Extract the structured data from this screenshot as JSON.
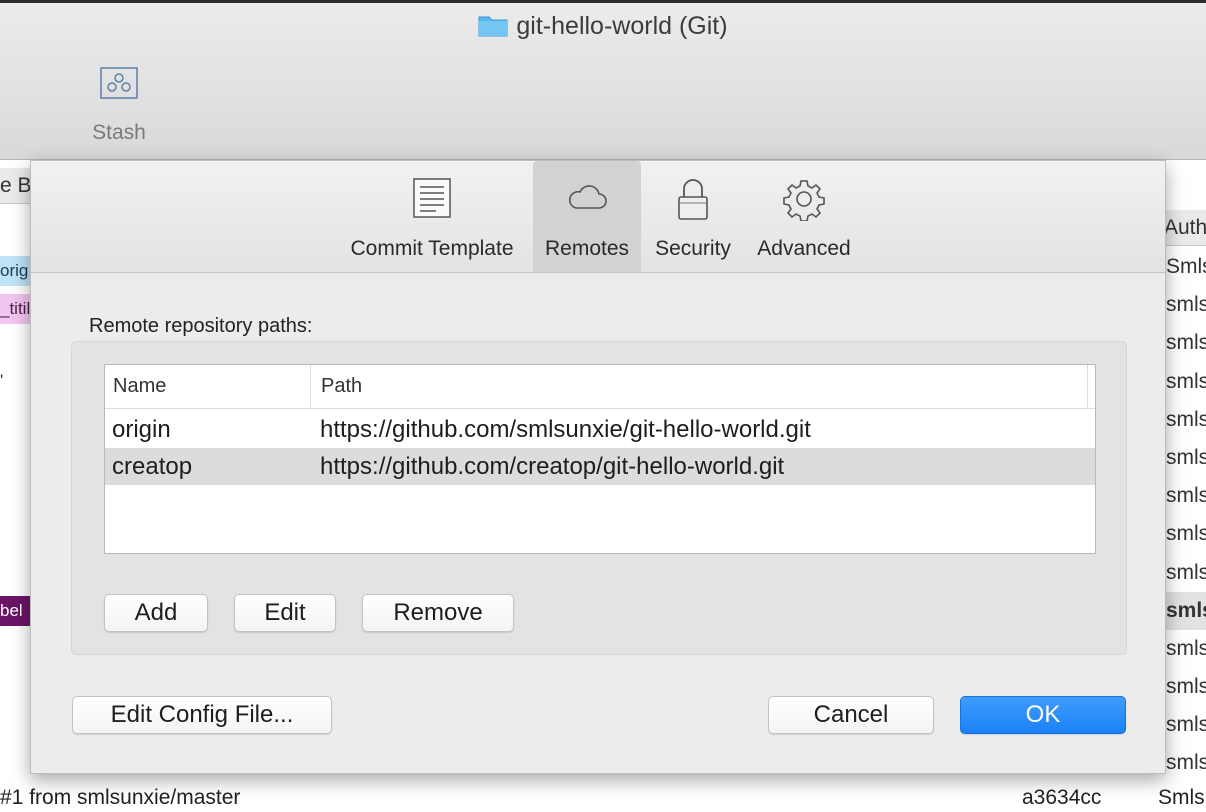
{
  "window": {
    "title": "git-hello-world (Git)",
    "toolbar": {
      "stash_label": "Stash"
    }
  },
  "background": {
    "left_header": "e B",
    "left_tags": [
      "orig",
      "_titil",
      "'",
      "bel"
    ],
    "author_header": "Auth",
    "authors": [
      "Smls",
      "smls",
      "smls",
      "smls",
      "smls",
      "smls",
      "smls",
      "smls",
      "smls",
      "smls",
      "smls",
      "smls",
      "smls",
      "smls"
    ],
    "bottom_row": {
      "message": "#1 from smlsunxie/master",
      "hash": "a3634cc",
      "author": "Smls"
    }
  },
  "preferences": {
    "tabs": [
      {
        "label": "Commit Template",
        "icon": "document-icon"
      },
      {
        "label": "Remotes",
        "icon": "cloud-icon"
      },
      {
        "label": "Security",
        "icon": "lock-icon"
      },
      {
        "label": "Advanced",
        "icon": "gear-icon"
      }
    ],
    "active_tab": "Remotes",
    "section_label": "Remote repository paths:",
    "table": {
      "columns": [
        "Name",
        "Path"
      ],
      "rows": [
        {
          "name": "origin",
          "path": "https://github.com/smlsunxie/git-hello-world.git"
        },
        {
          "name": "creatop",
          "path": "https://github.com/creatop/git-hello-world.git"
        }
      ],
      "selected_row": 1
    },
    "buttons": {
      "add": "Add",
      "edit": "Edit",
      "remove": "Remove",
      "edit_config": "Edit Config File...",
      "cancel": "Cancel",
      "ok": "OK"
    }
  },
  "colors": {
    "accent": "#1a82f6",
    "tag_origin": "#bfe3f7",
    "tag_titil": "#f2c6f1",
    "tag_bel": "#6b1466",
    "folder": "#5ab8ef"
  }
}
